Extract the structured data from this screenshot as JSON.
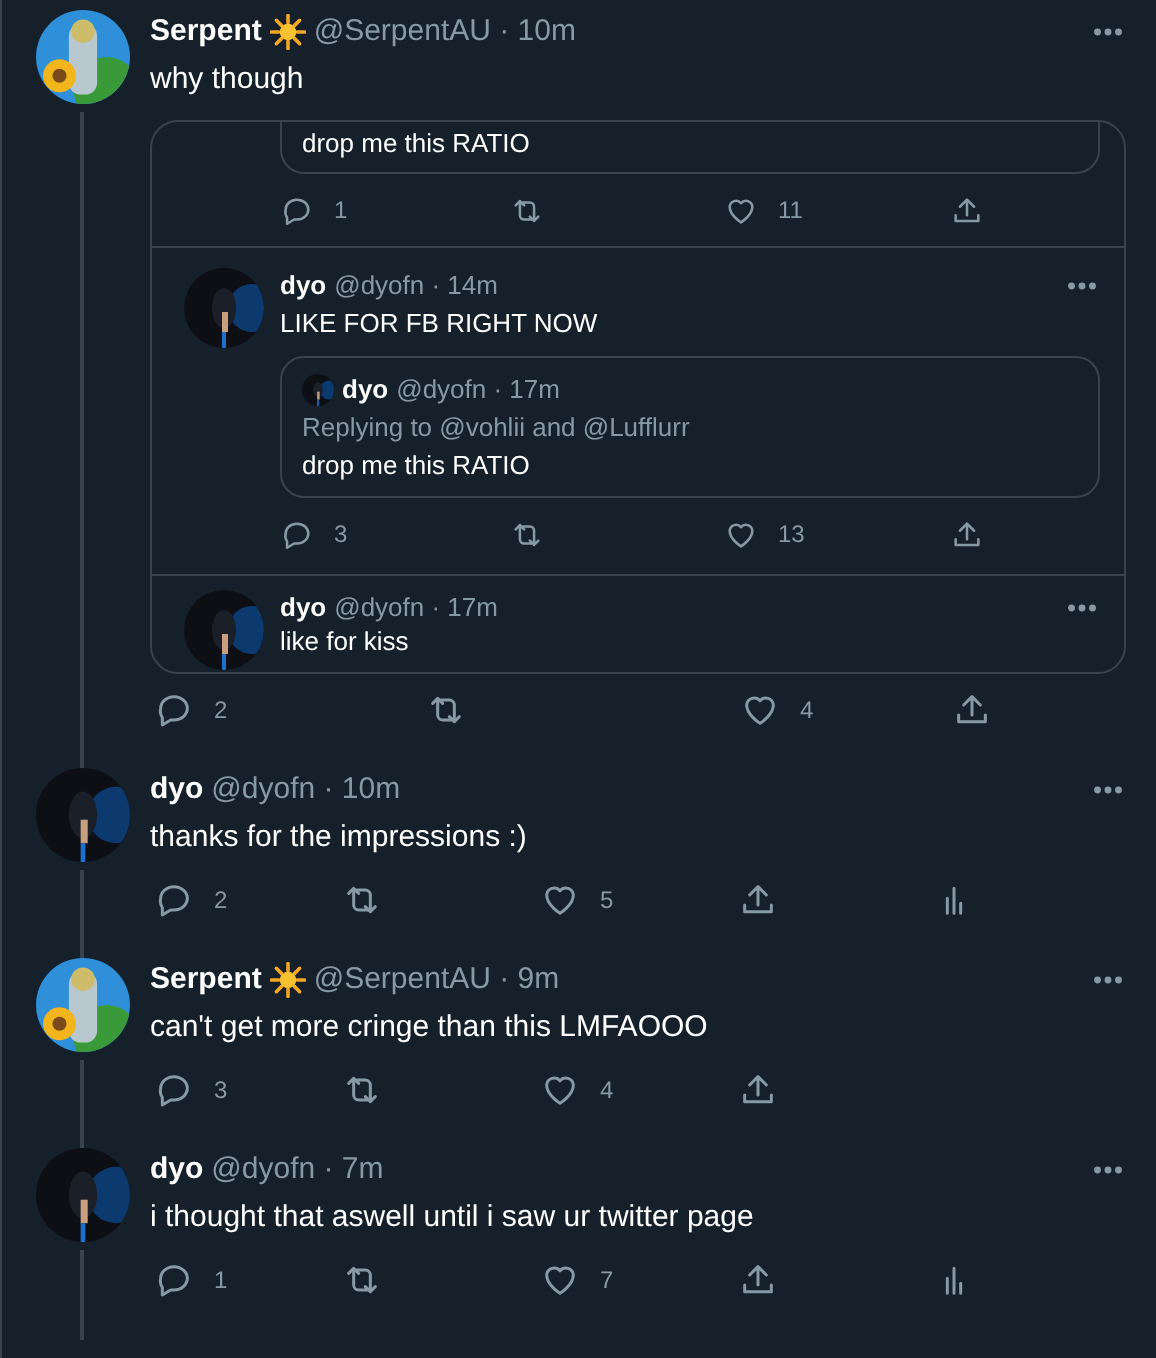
{
  "tweets": [
    {
      "author": "Serpent",
      "sun_badge": true,
      "meta": "@SerpentAU · 10m",
      "text": "why though",
      "thread_line": true,
      "embed": {
        "top_quote": {
          "text": "drop me this RATIO"
        },
        "top_stats": {
          "replies": "1",
          "likes": "11"
        },
        "replies": [
          {
            "author": "dyo",
            "meta": "@dyofn · 14m",
            "text": "LIKE FOR FB RIGHT NOW",
            "quote": {
              "author": "dyo",
              "meta": "@dyofn · 17m",
              "replying_to": "Replying to @vohlii and @Lufflurr",
              "text": "drop me this RATIO"
            },
            "stats": {
              "replies": "3",
              "likes": "13"
            }
          },
          {
            "author": "dyo",
            "meta": "@dyofn · 17m",
            "text": "like for kiss"
          }
        ]
      },
      "stats": {
        "replies": "2",
        "likes": "4"
      },
      "analytics": false
    },
    {
      "author": "dyo",
      "sun_badge": false,
      "meta": "@dyofn · 10m",
      "text": "thanks for the impressions :)",
      "thread_line": true,
      "stats": {
        "replies": "2",
        "likes": "5"
      },
      "analytics": true
    },
    {
      "author": "Serpent",
      "sun_badge": true,
      "meta": "@SerpentAU · 9m",
      "text": "can't get more cringe than this LMFAOOO",
      "thread_line": true,
      "stats": {
        "replies": "3",
        "likes": "4"
      },
      "analytics": false
    },
    {
      "author": "dyo",
      "sun_badge": false,
      "meta": "@dyofn · 7m",
      "text": "i thought that aswell until i saw ur twitter page",
      "thread_line": true,
      "stats": {
        "replies": "1",
        "likes": "7"
      },
      "analytics": true
    }
  ]
}
